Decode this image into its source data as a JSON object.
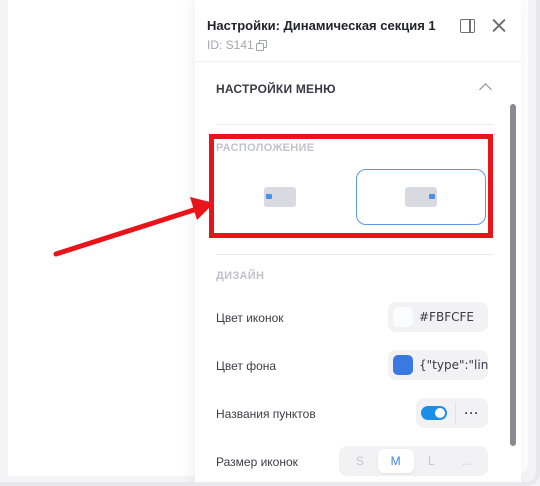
{
  "panel": {
    "title": "Настройки: Динамическая секция 1",
    "id_text": "ID: S141"
  },
  "menu_settings": {
    "heading": "НАСТРОЙКИ МЕНЮ",
    "layout_label": "РАСПОЛОЖЕНИЕ",
    "layout_options": [
      {
        "name": "left",
        "selected": false
      },
      {
        "name": "right",
        "selected": true
      }
    ],
    "design_label": "ДИЗАЙН",
    "icon_color_label": "Цвет иконок",
    "icon_color_value": "#FBFCFE",
    "bg_color_label": "Цвет фона",
    "bg_color_value": "{\"type\":\"lin",
    "item_names_label": "Названия пунктов",
    "item_names_enabled": true,
    "more_label": "···",
    "icon_size_label": "Размер иконок",
    "icon_sizes": [
      "S",
      "M",
      "L",
      "..."
    ],
    "icon_size_selected": "M"
  },
  "colors": {
    "accent": "#1b8fe8",
    "icon_swatch": "#FBFCFE",
    "bg_swatch": "#3a7ae0",
    "annotation": "#e8141a"
  }
}
